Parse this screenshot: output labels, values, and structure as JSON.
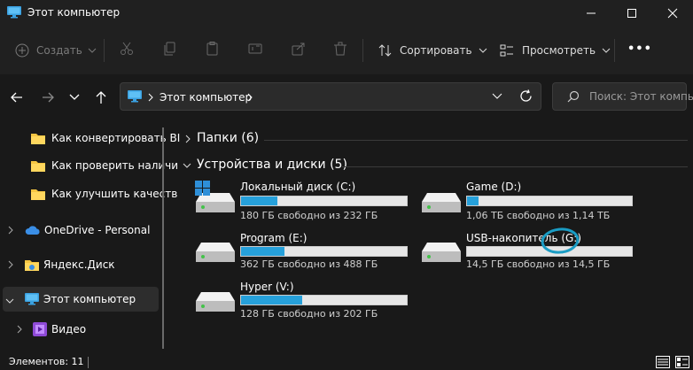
{
  "window": {
    "title": "Этот компьютер",
    "accent": "#26a0da",
    "annotation_color": "#1a9cc4"
  },
  "toolbar": {
    "create_label": "Создать",
    "sort_label": "Сортировать",
    "view_label": "Просмотреть",
    "more_label": "•••"
  },
  "address": {
    "segment": "Этот компьютер",
    "search_placeholder": "Поиск: Этот компь"
  },
  "nav": {
    "items": [
      {
        "label": "Как конвертировать BI"
      },
      {
        "label": "Как проверить наличи"
      },
      {
        "label": "Как улучшить качеств"
      },
      {
        "label": "OneDrive - Personal"
      },
      {
        "label": "Яндекс.Диск"
      },
      {
        "label": "Этот компьютер"
      },
      {
        "label": "Видео"
      }
    ]
  },
  "content": {
    "folders_header": "Папки (6)",
    "devices_header": "Устройства и диски (5)",
    "drives": [
      {
        "name": "Локальный диск (C:)",
        "info": "180 ГБ свободно из 232 ГБ",
        "used_fraction": 0.22
      },
      {
        "name": "Game (D:)",
        "info": "1,06 ТБ свободно из 1,14 ТБ",
        "used_fraction": 0.07
      },
      {
        "name": "Program (E:)",
        "info": "362 ГБ свободно из 488 ГБ",
        "used_fraction": 0.26
      },
      {
        "name": "USB-накопитель (G:)",
        "info": "14,5 ГБ свободно из 14,5 ГБ",
        "used_fraction": 0.0
      },
      {
        "name": "Hyper (V:)",
        "info": "128 ГБ свободно из 202 ГБ",
        "used_fraction": 0.37
      }
    ]
  },
  "status": {
    "text": "Элементов: 11"
  }
}
